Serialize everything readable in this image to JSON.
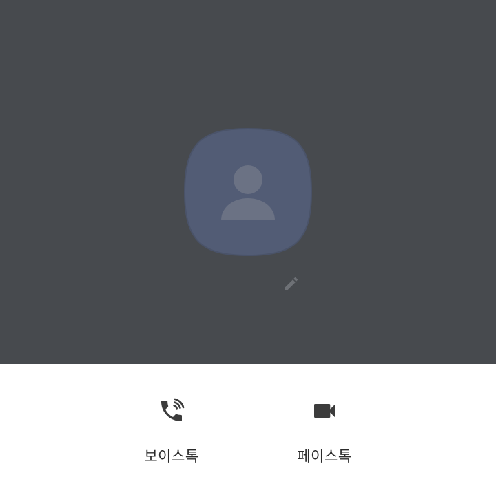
{
  "profile": {
    "avatar_icon": "person-icon",
    "edit_icon": "pencil-icon",
    "header_color": "#474a4e",
    "avatar_color": "#525c75"
  },
  "actions": [
    {
      "label": "보이스톡",
      "icon": "phone-call-icon"
    },
    {
      "label": "페이스톡",
      "icon": "video-camera-icon"
    }
  ]
}
